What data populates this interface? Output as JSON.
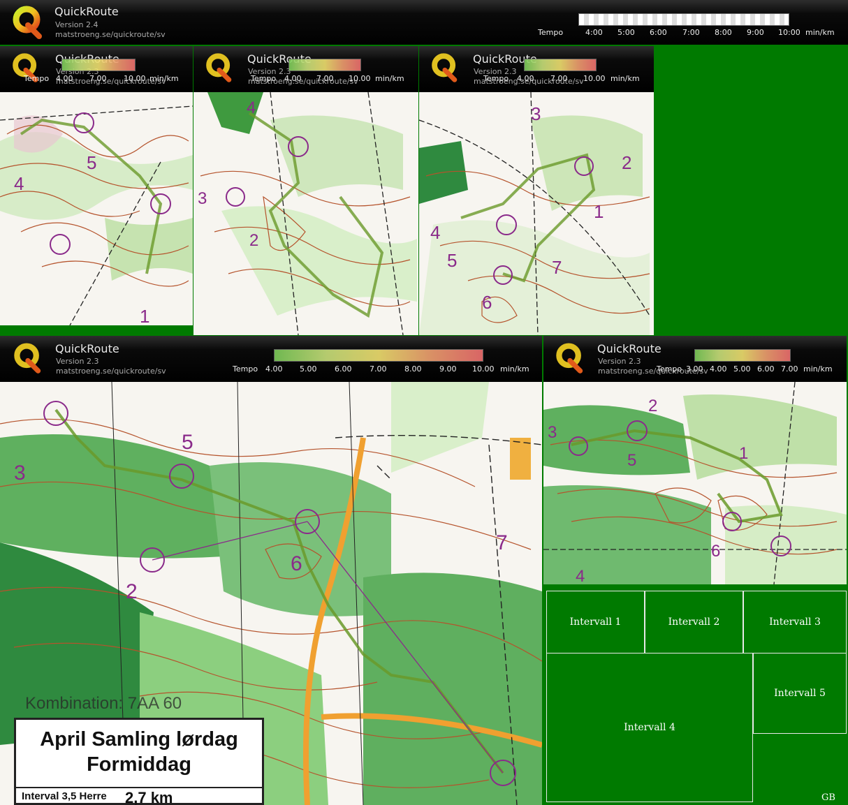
{
  "main_header": {
    "title": "QuickRoute",
    "version": "Version 2.4",
    "url": "matstroeng.se/quickroute/sv",
    "tempo_label": "Tempo",
    "ticks": [
      "4:00",
      "5:00",
      "6:00",
      "7:00",
      "8:00",
      "9:00",
      "10:00"
    ],
    "unit": "min/km"
  },
  "panels": [
    {
      "id": "intervall-1",
      "title": "QuickRoute",
      "version": "Version 2.3",
      "url": "matstroeng.se/quickroute/sv",
      "tempo_label": "Tempo",
      "ticks": [
        "4.00",
        "7.00",
        "10.00"
      ],
      "unit": "min/km"
    },
    {
      "id": "intervall-2",
      "title": "QuickRoute",
      "version": "Version 2.3",
      "url": "matstroeng.se/quickroute/sv",
      "tempo_label": "Tempo",
      "ticks": [
        "4.00",
        "7.00",
        "10.00"
      ],
      "unit": "min/km"
    },
    {
      "id": "intervall-3",
      "title": "QuickRoute",
      "version": "Version 2.3",
      "url": "matstroeng.se/quickroute/sv",
      "tempo_label": "Tempo",
      "ticks": [
        "4.00",
        "7.00",
        "10.00"
      ],
      "unit": "min/km"
    },
    {
      "id": "intervall-4",
      "title": "QuickRoute",
      "version": "Version 2.3",
      "url": "matstroeng.se/quickroute/sv",
      "tempo_label": "Tempo",
      "ticks": [
        "4.00",
        "5.00",
        "6.00",
        "7.00",
        "8.00",
        "9.00",
        "10.00"
      ],
      "unit": "min/km"
    },
    {
      "id": "intervall-5",
      "title": "QuickRoute",
      "version": "Version 2.3",
      "url": "matstroeng.se/quickroute/sv",
      "tempo_label": "Tempo",
      "ticks": [
        "3.00",
        "4.00",
        "5.00",
        "6.00",
        "7.00"
      ],
      "unit": "min/km"
    }
  ],
  "legend": {
    "cells": [
      "Intervall 1",
      "Intervall 2",
      "Intervall 3",
      "Intervall 4",
      "Intervall 5"
    ],
    "author": "GB"
  },
  "map_text": {
    "kombination": "Kombination: 7AA 60",
    "card_title_1": "April Samling lørdag",
    "card_title_2": "Formiddag",
    "card_interval": "Interval 3,5 Herre",
    "card_distance": "2,7 km"
  },
  "colors": {
    "background": "#007a00",
    "header": "#000000",
    "forest": "#3fa83f",
    "contour": "#b5532c",
    "route": "#6a9a2a",
    "control": "#8a2a8a"
  }
}
